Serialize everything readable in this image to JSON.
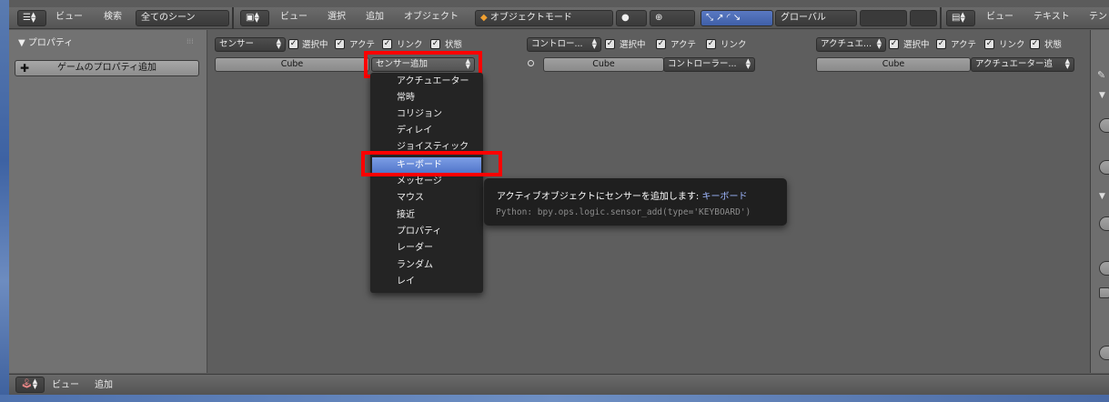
{
  "top_header": {
    "left_menu": [
      "ビュー",
      "検索"
    ],
    "scene_filter": "全てのシーン",
    "viewport_menu": [
      "ビュー",
      "選択",
      "追加",
      "オブジェクト"
    ],
    "mode": "オブジェクトモード",
    "orientation": "グローバル",
    "text_menu": [
      "ビュー",
      "テキスト",
      "テン"
    ]
  },
  "properties_panel": {
    "title": "▼ プロパティ",
    "add_button": "ゲームのプロパティ追加"
  },
  "sensors": {
    "type_select": "センサー",
    "checks": [
      "選択中",
      "アクテ",
      "リンク",
      "状態"
    ],
    "object": "Cube",
    "add_select": "センサー追加"
  },
  "controllers": {
    "type_select": "コントロー...",
    "checks": [
      "選択中",
      "アクテ",
      "リンク"
    ],
    "object": "Cube",
    "add_select": "コントローラー..."
  },
  "actuators": {
    "type_select": "アクチュエ...",
    "checks": [
      "選択中",
      "アクテ",
      "リンク",
      "状態"
    ],
    "object": "Cube",
    "add_select": "アクチュエーター追"
  },
  "sensor_menu": {
    "items": [
      "アクチュエーター",
      "常時",
      "コリジョン",
      "ディレイ",
      "ジョイスティック",
      "キーボード",
      "メッセージ",
      "マウス",
      "接近",
      "プロパティ",
      "レーダー",
      "ランダム",
      "レイ"
    ],
    "active_index": 5
  },
  "tooltip": {
    "text": "アクティブオブジェクトにセンサーを追加します:",
    "highlight": "キーボード",
    "python": "Python: bpy.ops.logic.sensor_add(type='KEYBOARD')"
  },
  "bottom_header": {
    "menu": [
      "ビュー",
      "追加"
    ]
  },
  "colors": {
    "highlight_red": "#ff0000",
    "menu_active_blue": "#5a7fd0",
    "tooltip_link": "#9fb8ff"
  }
}
